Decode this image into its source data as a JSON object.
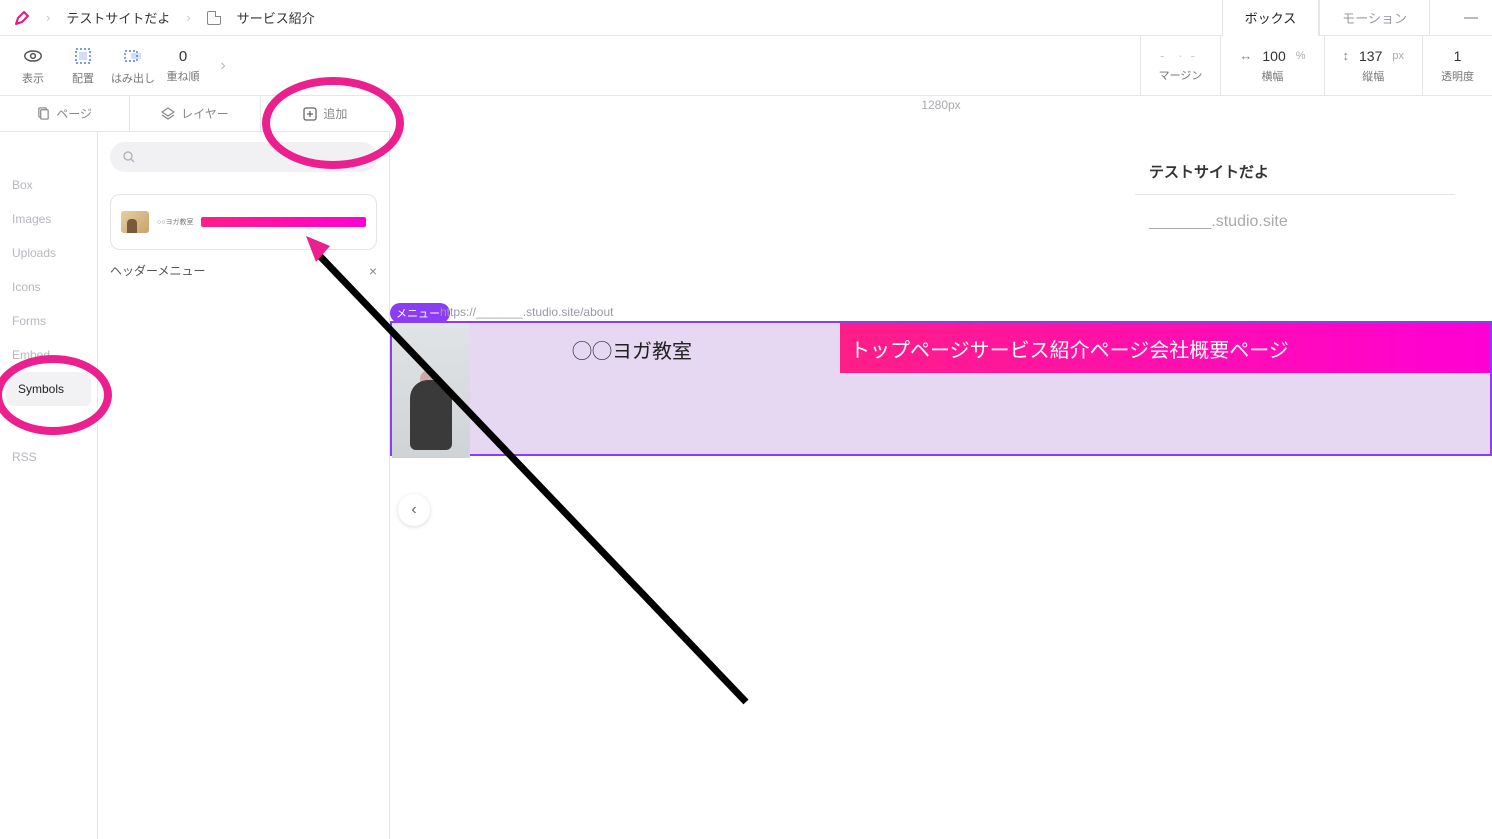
{
  "breadcrumb": {
    "site": "テストサイトだよ",
    "page": "サービス紹介"
  },
  "topTabs": {
    "box": "ボックス",
    "motion": "モーション"
  },
  "toolbar": {
    "display": "表示",
    "align": "配置",
    "overflow": "はみ出し",
    "stack": "重ね順",
    "stack_value": "0"
  },
  "props": {
    "margin_label": "マージン",
    "margin_value": "-  ·  -",
    "width_label": "横幅",
    "width_value": "100",
    "width_unit": "%",
    "height_label": "縦幅",
    "height_value": "137",
    "height_unit": "px",
    "opacity_label": "透明度",
    "opacity_value": "1"
  },
  "railTabs": {
    "pages": "ページ",
    "layers": "レイヤー",
    "add": "追加"
  },
  "categories": {
    "box": "Box",
    "images": "Images",
    "uploads": "Uploads",
    "icons": "Icons",
    "forms": "Forms",
    "embed": "Embed",
    "symbols": "Symbols",
    "rss": "RSS"
  },
  "symbol": {
    "preview_title": "○○ヨガ教室",
    "name": "ヘッダーメニュー"
  },
  "canvas": {
    "ruler": "1280px",
    "frame_title": "テストサイトだよ",
    "frame_domain": "_______.studio.site",
    "selected_badge": "メニュー",
    "selected_url": "https://_______.studio.site/about",
    "header_title": "◯◯ヨガ教室",
    "nav_text": "トップページサービス紹介ページ会社概要ページ"
  }
}
